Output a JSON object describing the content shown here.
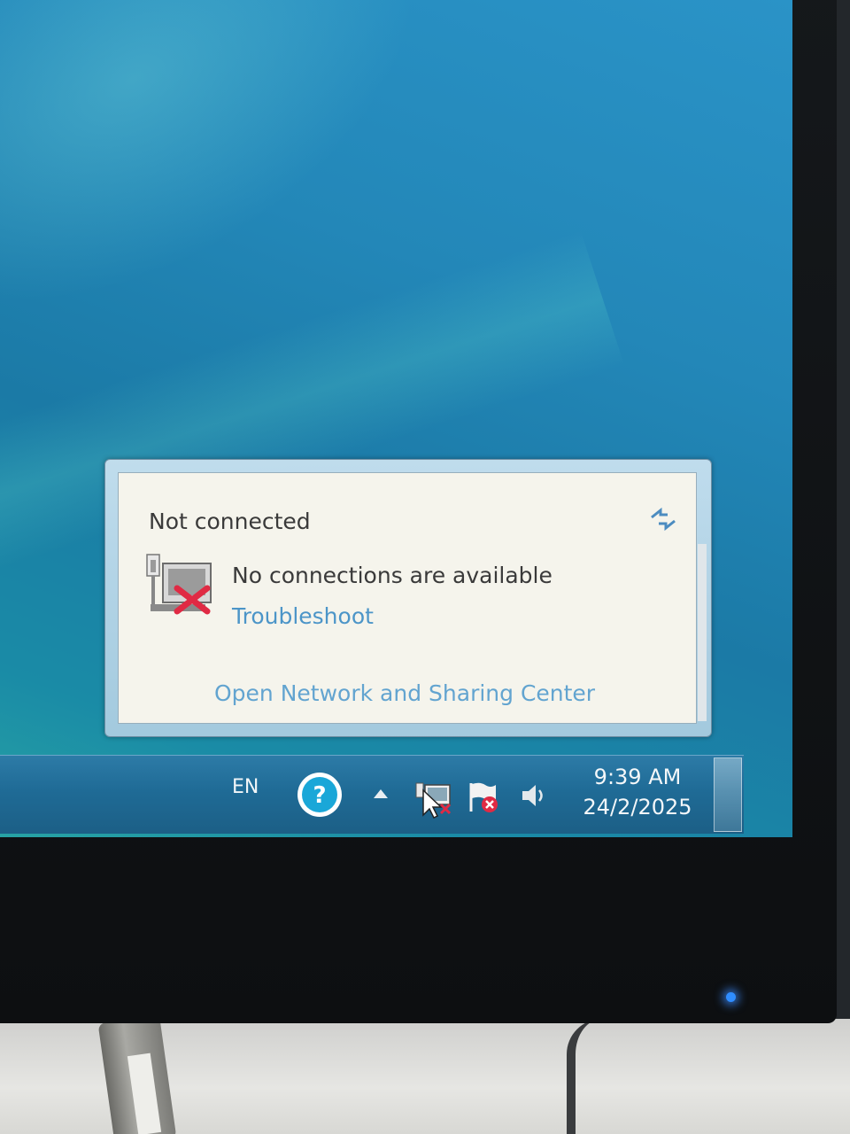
{
  "popup": {
    "title": "Not connected",
    "status_text": "No connections are available",
    "troubleshoot_link": "Troubleshoot",
    "network_center_link": "Open Network and Sharing Center",
    "refresh_icon": "refresh-arrows-icon",
    "network_icon": "network-disconnected-icon"
  },
  "taskbar": {
    "language": "EN",
    "help_icon": "help-question-icon",
    "overflow_icon": "show-hidden-icons-arrow",
    "network_tray_icon": "network-tray-icon",
    "action_center_icon": "action-center-flag-icon",
    "volume_icon": "volume-icon",
    "clock_time": "9:39 AM",
    "clock_date": "24/2/2025"
  },
  "colors": {
    "link": "#4c95c8",
    "taskbar": "#1f6b96",
    "desktop": "#2387b8",
    "error_x": "#e02a44"
  }
}
